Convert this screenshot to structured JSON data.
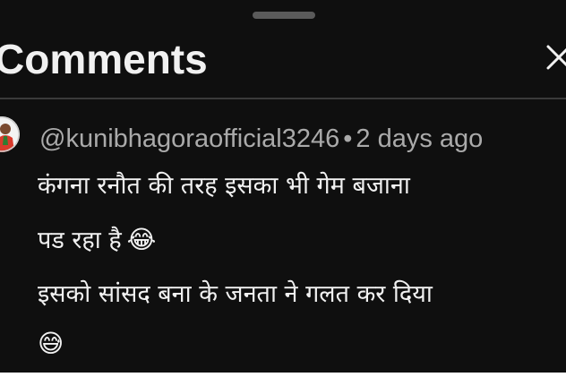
{
  "sheet": {
    "title": "Comments"
  },
  "comment": {
    "author": "@kunibhagoraofficial3246",
    "separator": "•",
    "time": "2 days ago",
    "lines": [
      {
        "text": "कंगना रनौत की तरह इसका भी गेम बजाना",
        "emoji": ""
      },
      {
        "text": "पड रहा है",
        "emoji": "😂"
      },
      {
        "text": "इसको सांसद बना के जनता ने गलत कर दिया",
        "emoji": ""
      },
      {
        "text": "",
        "emoji": "😅"
      }
    ]
  },
  "icons": {
    "close": "close-icon",
    "avatar": "avatar-image"
  },
  "colors": {
    "background": "#0f0f0f",
    "primary_text": "#f1f1f1",
    "secondary_text": "#aaaaaa",
    "divider": "#3a3a3a",
    "handle": "#5a5a5a"
  }
}
